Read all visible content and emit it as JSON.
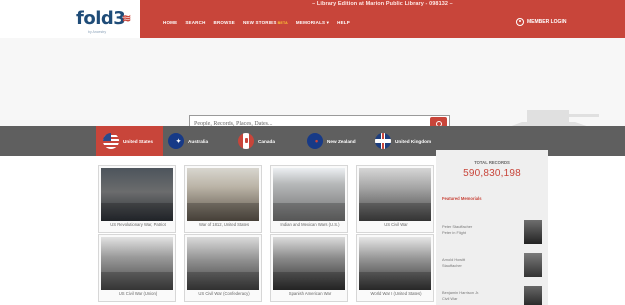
{
  "library_line": "– Library Edition at Marion Public Library - 098132 –",
  "brand": {
    "logo_text": "fold3",
    "tagline": "by Ancestry"
  },
  "nav": [
    {
      "label": "HOME"
    },
    {
      "label": "SEARCH"
    },
    {
      "label": "BROWSE"
    },
    {
      "label": "NEW STORIES",
      "badge": "BETA"
    },
    {
      "label": "MEMORIALS ▾"
    },
    {
      "label": "HELP"
    }
  ],
  "member_login": "MEMBER LOGIN",
  "search": {
    "placeholder": "People, Records, Places, Dates..."
  },
  "countries": [
    {
      "label": "United States",
      "flag": "us-flag-icon",
      "active": true
    },
    {
      "label": "Australia",
      "flag": "au-flag-icon",
      "active": false
    },
    {
      "label": "Canada",
      "flag": "ca-flag-icon",
      "active": false
    },
    {
      "label": "New Zealand",
      "flag": "nz-flag-icon",
      "active": false
    },
    {
      "label": "United Kingdom",
      "flag": "uk-flag-icon",
      "active": false
    }
  ],
  "collections": [
    {
      "caption": "US Revolutionary War, Patriot"
    },
    {
      "caption": "War of 1812, United States"
    },
    {
      "caption": "Indian and Mexican Wars (U.S.)"
    },
    {
      "caption": "US Civil War"
    },
    {
      "caption": "US Civil War (Union)"
    },
    {
      "caption": "US Civil War (Confederacy)"
    },
    {
      "caption": "Spanish American War"
    },
    {
      "caption": "World War I (United States)"
    }
  ],
  "right_panel": {
    "records_label": "TOTAL RECORDS",
    "records_value": "590,830,198",
    "featured_label": "Featured Memorials",
    "members": [
      {
        "name": "Peter Stauffacher",
        "meta": "Peter in Flight"
      },
      {
        "name": "Arnold Howitt",
        "meta": "Stauffacher"
      },
      {
        "name": "Benjamin Harrison Jr.",
        "meta": "Civil War"
      }
    ]
  },
  "colors": {
    "brand_red": "#c8453a",
    "dark_strip": "#5f5f5f",
    "panel_bg": "#efefef"
  }
}
